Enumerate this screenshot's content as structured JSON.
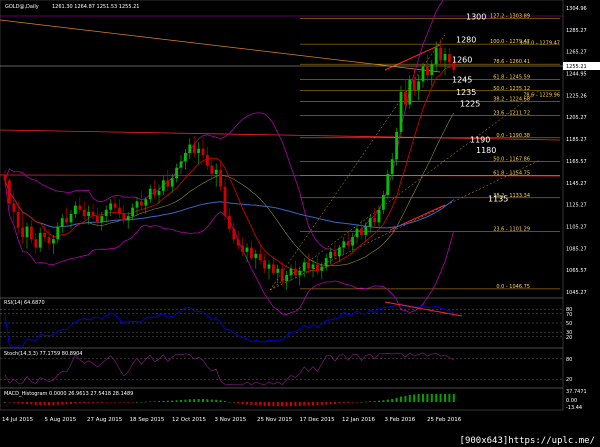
{
  "window": {
    "symbol_line": "GOLD@,Daily",
    "ohlc": "1261.30 1264.87 1251.53 1255.21"
  },
  "colors": {
    "background": "#000000",
    "bull": "#00c000",
    "bear": "#d00000",
    "fib": "#d4a017",
    "fib_level_text": "#ffd24a",
    "bollinger": "#b000b0",
    "ma_fast": "#e00000",
    "ma_slow": "#3a66c8",
    "trend_red": "#ff2020",
    "trend_orange": "#e08020",
    "rsi_line": "#0000ff",
    "stoch_main": "#7a1a7a",
    "macd_hist": "#00a000",
    "grid": "#808080",
    "cursor_line": "#c000c0"
  },
  "price_axis": {
    "labels": [
      "1304.96",
      "1285.27",
      "1265.27",
      "1244.95",
      "1225.26",
      "1205.27",
      "1185.27",
      "1165.57",
      "1145.27",
      "1125.27",
      "1105.27",
      "1085.27",
      "1065.57",
      "1045.27"
    ],
    "current_tag": "1255.21",
    "range": [
      1040,
      1310
    ]
  },
  "date_axis": {
    "labels": [
      "14 Jul 2015",
      "5 Aug 2015",
      "27 Aug 2015",
      "18 Sep 2015",
      "12 Oct 2015",
      "3 Nov 2015",
      "25 Nov 2015",
      "17 Dec 2015",
      "12 Jan 2016",
      "3 Feb 2016",
      "25 Feb 2016"
    ]
  },
  "fib_levels": [
    {
      "label": "127.2 - 1303.89",
      "value": 1303.89
    },
    {
      "label": "100.0 - 1279.47",
      "value": 1279.47
    },
    {
      "label": "78.6 - 1260.41",
      "value": 1260.41
    },
    {
      "label": "61.8 - 1245.59",
      "value": 1245.59
    },
    {
      "label": "50.0 - 1235.12",
      "value": 1235.12
    },
    {
      "label": "38.2 - 1224.68",
      "value": 1224.68
    },
    {
      "label": "23.6 - 1211.72",
      "value": 1211.72
    },
    {
      "label": "0.0 - 1190.38",
      "value": 1190.38
    },
    {
      "label": "50.0 - 1167.86",
      "value": 1167.86
    },
    {
      "label": "61.8 - 1154.75",
      "value": 1154.75
    },
    {
      "label": "38.2 - 1133.34",
      "value": 1133.34
    },
    {
      "label": "23.6 - 1101.29",
      "value": 1101.29
    },
    {
      "label": "0.0 - 1046.75",
      "value": 1046.75
    }
  ],
  "side_fib_tags": [
    {
      "label": "100.0 - 1279.47",
      "value": 1279.47
    },
    {
      "label": "78.6 - 1229.96",
      "value": 1229.96
    }
  ],
  "level_labels": [
    {
      "text": "1300",
      "value": 1303
    },
    {
      "text": "1280",
      "value": 1281
    },
    {
      "text": "1260",
      "value": 1262
    },
    {
      "text": "1245",
      "value": 1243
    },
    {
      "text": "1235",
      "value": 1231
    },
    {
      "text": "1225",
      "value": 1220
    },
    {
      "text": "1190",
      "value": 1186
    },
    {
      "text": "1180",
      "value": 1176
    },
    {
      "text": "1135",
      "value": 1130
    }
  ],
  "indicators": {
    "rsi": {
      "label": "RSI(14) 64.6870",
      "value": 64.687,
      "levels": [
        "80",
        "70",
        "50",
        "30",
        "20"
      ]
    },
    "stoch": {
      "label": "Stoch(14,3,3) 77.1759 80.8904",
      "main": 77.1759,
      "signal": 80.8904,
      "levels": [
        "80",
        "20"
      ]
    },
    "macd": {
      "label": "MACD_Histogram 0.0000 26.9613 27.5418 28.1489",
      "axis": [
        "37.7471",
        "0.00",
        "-13.44"
      ]
    }
  },
  "chart_data": {
    "type": "candlestick",
    "title": "GOLD@,Daily",
    "ylim": [
      1040,
      1310
    ],
    "candles": [
      [
        1155,
        1160,
        1145,
        1150
      ],
      [
        1150,
        1152,
        1125,
        1128
      ],
      [
        1128,
        1140,
        1110,
        1120
      ],
      [
        1120,
        1130,
        1100,
        1105
      ],
      [
        1105,
        1120,
        1090,
        1096
      ],
      [
        1096,
        1110,
        1085,
        1106
      ],
      [
        1106,
        1112,
        1090,
        1094
      ],
      [
        1094,
        1100,
        1080,
        1086
      ],
      [
        1086,
        1105,
        1082,
        1100
      ],
      [
        1100,
        1108,
        1092,
        1096
      ],
      [
        1096,
        1104,
        1084,
        1090
      ],
      [
        1090,
        1098,
        1080,
        1094
      ],
      [
        1094,
        1110,
        1090,
        1106
      ],
      [
        1106,
        1118,
        1100,
        1114
      ],
      [
        1114,
        1124,
        1108,
        1110
      ],
      [
        1110,
        1122,
        1104,
        1118
      ],
      [
        1118,
        1130,
        1114,
        1126
      ],
      [
        1126,
        1134,
        1118,
        1122
      ],
      [
        1122,
        1130,
        1112,
        1116
      ],
      [
        1116,
        1126,
        1108,
        1120
      ],
      [
        1120,
        1128,
        1112,
        1116
      ],
      [
        1116,
        1124,
        1106,
        1110
      ],
      [
        1110,
        1120,
        1102,
        1116
      ],
      [
        1116,
        1126,
        1110,
        1122
      ],
      [
        1122,
        1132,
        1116,
        1128
      ],
      [
        1128,
        1136,
        1118,
        1124
      ],
      [
        1124,
        1132,
        1114,
        1118
      ],
      [
        1118,
        1126,
        1108,
        1112
      ],
      [
        1112,
        1120,
        1104,
        1116
      ],
      [
        1116,
        1128,
        1112,
        1124
      ],
      [
        1124,
        1134,
        1116,
        1130
      ],
      [
        1130,
        1140,
        1122,
        1126
      ],
      [
        1126,
        1134,
        1118,
        1132
      ],
      [
        1132,
        1146,
        1128,
        1142
      ],
      [
        1142,
        1150,
        1132,
        1136
      ],
      [
        1136,
        1146,
        1128,
        1140
      ],
      [
        1140,
        1154,
        1136,
        1150
      ],
      [
        1150,
        1160,
        1140,
        1144
      ],
      [
        1144,
        1156,
        1138,
        1152
      ],
      [
        1152,
        1166,
        1148,
        1162
      ],
      [
        1162,
        1174,
        1156,
        1168
      ],
      [
        1168,
        1180,
        1160,
        1176
      ],
      [
        1176,
        1190,
        1170,
        1184
      ],
      [
        1184,
        1192,
        1172,
        1176
      ],
      [
        1176,
        1186,
        1166,
        1180
      ],
      [
        1180,
        1190,
        1170,
        1174
      ],
      [
        1174,
        1182,
        1160,
        1164
      ],
      [
        1164,
        1172,
        1150,
        1156
      ],
      [
        1156,
        1166,
        1144,
        1160
      ],
      [
        1160,
        1168,
        1140,
        1144
      ],
      [
        1144,
        1152,
        1112,
        1116
      ],
      [
        1116,
        1124,
        1100,
        1104
      ],
      [
        1104,
        1110,
        1090,
        1094
      ],
      [
        1094,
        1102,
        1084,
        1088
      ],
      [
        1088,
        1096,
        1078,
        1082
      ],
      [
        1082,
        1090,
        1072,
        1086
      ],
      [
        1086,
        1092,
        1074,
        1076
      ],
      [
        1076,
        1084,
        1066,
        1080
      ],
      [
        1080,
        1088,
        1070,
        1074
      ],
      [
        1074,
        1080,
        1062,
        1066
      ],
      [
        1066,
        1074,
        1056,
        1070
      ],
      [
        1070,
        1078,
        1060,
        1062
      ],
      [
        1062,
        1070,
        1052,
        1066
      ],
      [
        1066,
        1072,
        1050,
        1054
      ],
      [
        1054,
        1064,
        1046,
        1060
      ],
      [
        1060,
        1070,
        1054,
        1066
      ],
      [
        1066,
        1074,
        1056,
        1060
      ],
      [
        1060,
        1068,
        1050,
        1064
      ],
      [
        1064,
        1076,
        1058,
        1072
      ],
      [
        1072,
        1080,
        1062,
        1066
      ],
      [
        1066,
        1074,
        1058,
        1070
      ],
      [
        1070,
        1078,
        1060,
        1064
      ],
      [
        1064,
        1072,
        1056,
        1068
      ],
      [
        1068,
        1080,
        1064,
        1076
      ],
      [
        1076,
        1086,
        1070,
        1082
      ],
      [
        1082,
        1090,
        1074,
        1078
      ],
      [
        1078,
        1088,
        1072,
        1086
      ],
      [
        1086,
        1096,
        1080,
        1092
      ],
      [
        1092,
        1100,
        1084,
        1088
      ],
      [
        1088,
        1100,
        1082,
        1096
      ],
      [
        1096,
        1108,
        1090,
        1104
      ],
      [
        1104,
        1112,
        1094,
        1098
      ],
      [
        1098,
        1110,
        1092,
        1106
      ],
      [
        1106,
        1118,
        1100,
        1114
      ],
      [
        1114,
        1124,
        1106,
        1110
      ],
      [
        1110,
        1126,
        1106,
        1122
      ],
      [
        1122,
        1140,
        1118,
        1136
      ],
      [
        1136,
        1160,
        1132,
        1156
      ],
      [
        1156,
        1176,
        1150,
        1170
      ],
      [
        1170,
        1200,
        1164,
        1196
      ],
      [
        1196,
        1240,
        1190,
        1234
      ],
      [
        1234,
        1246,
        1216,
        1222
      ],
      [
        1222,
        1250,
        1218,
        1246
      ],
      [
        1246,
        1256,
        1230,
        1236
      ],
      [
        1236,
        1250,
        1226,
        1244
      ],
      [
        1244,
        1262,
        1238,
        1258
      ],
      [
        1258,
        1270,
        1244,
        1250
      ],
      [
        1250,
        1264,
        1240,
        1260
      ],
      [
        1260,
        1282,
        1254,
        1276
      ],
      [
        1276,
        1284,
        1258,
        1264
      ],
      [
        1264,
        1276,
        1250,
        1270
      ],
      [
        1270,
        1276,
        1256,
        1262
      ],
      [
        1262,
        1266,
        1252,
        1255
      ]
    ]
  }
}
